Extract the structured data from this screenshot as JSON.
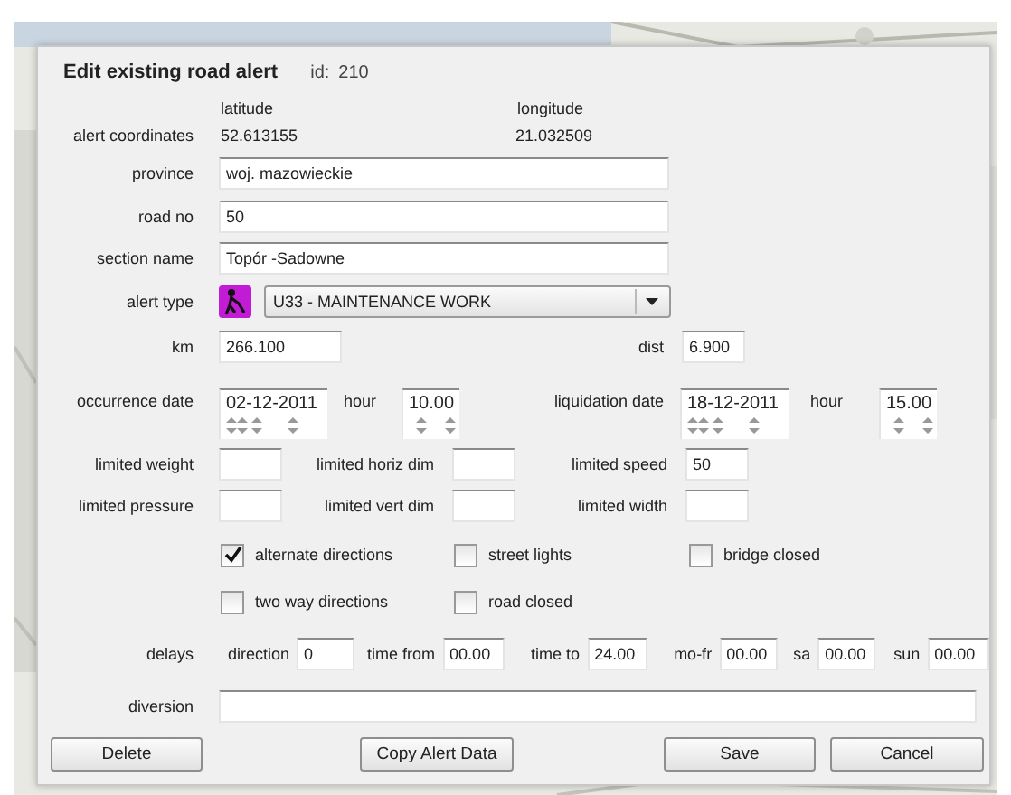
{
  "dialog": {
    "title": "Edit existing road alert",
    "id_label": "id:",
    "id_value": "210"
  },
  "coordinates": {
    "label": "alert coordinates",
    "latitude_label": "latitude",
    "latitude": "52.613155",
    "longitude_label": "longitude",
    "longitude": "21.032509"
  },
  "fields": [
    {
      "label": "province",
      "value": "woj. mazowieckie"
    },
    {
      "label": "road no",
      "value": "50"
    },
    {
      "label": "section name",
      "value": "Topór -Sadowne"
    }
  ],
  "alert_type": {
    "label": "alert type",
    "value": "U33 - MAINTENANCE WORK"
  },
  "km": {
    "label": "km",
    "value": "266.100"
  },
  "dist": {
    "label": "dist",
    "value": "6.900"
  },
  "dates": [
    {
      "label": "occurrence date",
      "date": "02-12-2011",
      "hour_label": "hour",
      "hour": "10.00"
    },
    {
      "label": "liquidation date",
      "date": "18-12-2011",
      "hour_label": "hour",
      "hour": "15.00"
    }
  ],
  "limits": [
    {
      "label": "limited weight"
    },
    {
      "label": "limited horiz dim"
    },
    {
      "label": "limited speed",
      "value": "50"
    },
    {
      "label": "limited pressure"
    },
    {
      "label": "limited vert dim"
    },
    {
      "label": "limited width"
    }
  ],
  "checkboxes": [
    {
      "label": "alternate directions",
      "checked": true
    },
    {
      "label": "two way directions",
      "checked": false
    },
    {
      "label": "street lights",
      "checked": false
    },
    {
      "label": "road closed",
      "checked": false
    },
    {
      "label": "bridge closed",
      "checked": false
    }
  ],
  "delays": {
    "label": "delays",
    "items": [
      {
        "label": "direction",
        "value": "0"
      },
      {
        "label": "time from",
        "value": "00.00"
      },
      {
        "label": "time to",
        "value": "24.00"
      },
      {
        "label": "mo-fr",
        "value": "00.00"
      },
      {
        "label": "sa",
        "value": "00.00"
      },
      {
        "label": "sun",
        "value": "00.00"
      }
    ]
  },
  "diversion": {
    "label": "diversion"
  },
  "buttons": [
    "Delete",
    "Copy Alert Data",
    "Save",
    "Cancel"
  ]
}
